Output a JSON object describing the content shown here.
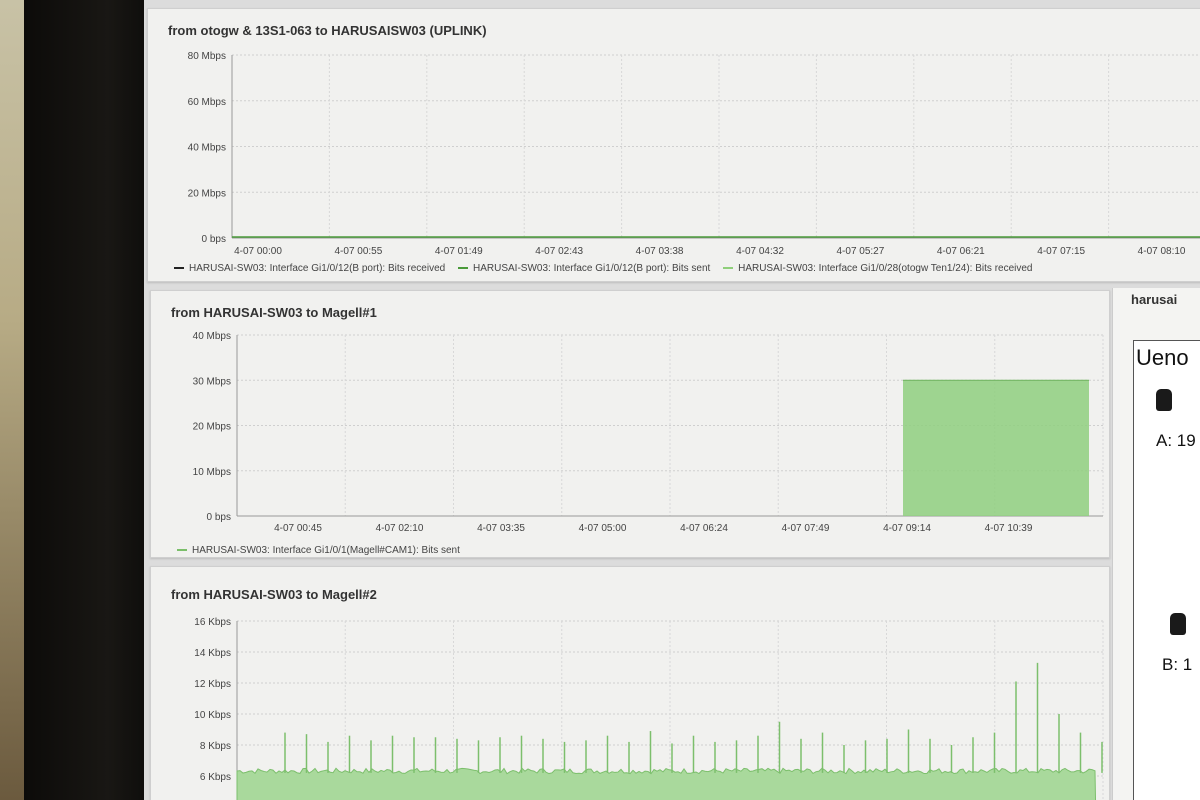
{
  "panels": [
    {
      "title": "from otogw & 13S1-063 to HARUSAISW03 (UPLINK)",
      "y_ticks": [
        "80 Mbps",
        "60 Mbps",
        "40 Mbps",
        "20 Mbps",
        "0 bps"
      ],
      "x_ticks": [
        "4-07 00:00",
        "4-07 00:55",
        "4-07 01:49",
        "4-07 02:43",
        "4-07 03:38",
        "4-07 04:32",
        "4-07 05:27",
        "4-07 06:21",
        "4-07 07:15",
        "4-07 08:10"
      ],
      "legend": [
        {
          "label": "HARUSAI-SW03: Interface Gi1/0/12(B port): Bits received",
          "color": "#222222"
        },
        {
          "label": "HARUSAI-SW03: Interface Gi1/0/12(B port): Bits sent",
          "color": "#4a9a3a"
        },
        {
          "label": "HARUSAI-SW03: Interface Gi1/0/28(otogw  Ten1/24): Bits received",
          "color": "#8fcf7a"
        }
      ]
    },
    {
      "title": "from HARUSAI-SW03 to Magell#1",
      "y_ticks": [
        "40 Mbps",
        "30 Mbps",
        "20 Mbps",
        "10 Mbps",
        "0 bps"
      ],
      "x_ticks": [
        "4-07 00:45",
        "4-07 02:10",
        "4-07 03:35",
        "4-07 05:00",
        "4-07 06:24",
        "4-07 07:49",
        "4-07 09:14",
        "4-07 10:39"
      ],
      "legend": [
        {
          "label": "HARUSAI-SW03: Interface Gi1/0/1(Magell#CAM1): Bits sent",
          "color": "#7bbf6a"
        }
      ]
    },
    {
      "title": "from HARUSAI-SW03 to Magell#2",
      "y_ticks": [
        "16 Kbps",
        "14 Kbps",
        "12 Kbps",
        "10 Kbps",
        "8 Kbps",
        "6 Kbps"
      ]
    }
  ],
  "side": {
    "title": "harusai",
    "heading": "Ueno",
    "item_a": "A: 19",
    "item_b": "B: 1",
    "icon": "camera-icon"
  },
  "colors": {
    "fill_green": "#8fcf7f",
    "grid": "#cfcfcf"
  },
  "chart_data": [
    {
      "type": "line",
      "title": "from otogw & 13S1-063 to HARUSAISW03 (UPLINK)",
      "x": [
        "4-07 00:00",
        "4-07 00:55",
        "4-07 01:49",
        "4-07 02:43",
        "4-07 03:38",
        "4-07 04:32",
        "4-07 05:27",
        "4-07 06:21",
        "4-07 07:15",
        "4-07 08:10"
      ],
      "series": [
        {
          "name": "HARUSAI-SW03: Interface Gi1/0/12(B port): Bits received",
          "values": [
            0,
            0,
            0,
            0,
            0,
            0,
            0,
            0,
            0,
            0
          ]
        },
        {
          "name": "HARUSAI-SW03: Interface Gi1/0/12(B port): Bits sent",
          "values": [
            0,
            0,
            0,
            0,
            0,
            0,
            0,
            0,
            0,
            0
          ]
        },
        {
          "name": "HARUSAI-SW03: Interface Gi1/0/28(otogw  Ten1/24): Bits received",
          "values": [
            0,
            0,
            0,
            0,
            0,
            0,
            0,
            0,
            0,
            0
          ]
        }
      ],
      "ylim_mbps": [
        0,
        80
      ],
      "grid": true,
      "legend": "bottom"
    },
    {
      "type": "area",
      "title": "from HARUSAI-SW03 to Magell#1",
      "x": [
        "4-07 00:45",
        "4-07 02:10",
        "4-07 03:35",
        "4-07 05:00",
        "4-07 06:24",
        "4-07 07:49",
        "4-07 09:14",
        "4-07 10:39"
      ],
      "series": [
        {
          "name": "HARUSAI-SW03: Interface Gi1/0/1(Magell#CAM1): Bits sent",
          "values": [
            0,
            0,
            0,
            0,
            0,
            0,
            30,
            30
          ],
          "start_time": "4-07 08:45",
          "end_time": "4-07 11:20"
        }
      ],
      "ylim_mbps": [
        0,
        40
      ],
      "grid": true,
      "legend": "bottom"
    },
    {
      "type": "area",
      "title": "from HARUSAI-SW03 to Magell#2",
      "series": [
        {
          "baseline_kbps": 6.0,
          "spike_kbps": [
            8.8,
            8.7,
            8.2,
            8.6,
            8.3,
            8.6,
            8.5,
            8.5,
            8.4,
            8.3,
            8.5,
            8.6,
            8.4,
            8.2,
            8.3,
            8.6,
            8.2,
            8.9,
            8.1,
            8.6,
            8.2,
            8.3,
            8.6,
            9.5,
            8.4,
            8.8,
            8.0,
            8.3,
            8.4,
            9.0,
            8.4,
            8.0,
            8.5,
            8.8,
            12.1,
            13.3,
            10.0,
            8.8,
            8.2
          ]
        }
      ],
      "ylim_kbps": [
        6,
        16
      ],
      "grid": true
    }
  ]
}
